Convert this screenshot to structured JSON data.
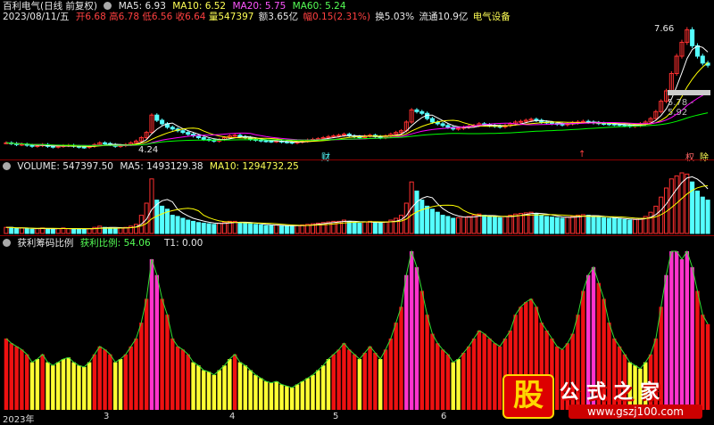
{
  "header": {
    "title": "百利电气(日线 前复权)",
    "ma5": "MA5: 6.93",
    "ma10": "MA10: 6.52",
    "ma20": "MA20: 5.75",
    "ma60": "MA60: 5.24"
  },
  "info": {
    "date": "2023/08/11/五",
    "open": "开6.68",
    "high": "高6.78",
    "low": "低6.56",
    "close": "收6.64",
    "volume": "量547397",
    "amount": "额3.65亿",
    "change": "幅0.15(2.31%)",
    "turnover": "换5.03%",
    "float_cap": "流通10.9亿",
    "sector": "电气设备"
  },
  "price_panel": {
    "high_label": "7.66",
    "low_label": "4.24",
    "range_label": "5.78 - 5.92",
    "marker_cai": "财",
    "marker_right1": "权",
    "marker_right2": "除",
    "marker_mid": "↑"
  },
  "volume_panel": {
    "volume": "VOLUME: 547397.50",
    "ma5": "MA5: 1493129.38",
    "ma10": "MA10: 1294732.25"
  },
  "profit_panel": {
    "title": "获利筹码比例",
    "ratio": "获利比例: 54.06",
    "t1": "T1: 0.00"
  },
  "dates": [
    "2023年",
    "3",
    "4",
    "5",
    "6"
  ],
  "watermark": {
    "logo": "股",
    "title": "公式之家",
    "url": "www.gszj100.com"
  },
  "colors": {
    "up": "#ff3030",
    "down": "#55ffff",
    "ma5": "#ffffff",
    "ma10": "#ffff00",
    "ma20": "#ff00ff",
    "ma60": "#00ff00",
    "profit_high": "#ff33cc",
    "profit_mid": "#ee1111",
    "profit_low": "#ffff33"
  },
  "chart_data": [
    {
      "type": "candlestick",
      "title": "百利电气(日线 前复权)",
      "series": [
        {
          "name": "MA5",
          "value": 6.93
        },
        {
          "name": "MA10",
          "value": 6.52
        },
        {
          "name": "MA20",
          "value": 5.75
        },
        {
          "name": "MA60",
          "value": 5.24
        }
      ],
      "close": [
        4.4,
        4.38,
        4.35,
        4.36,
        4.33,
        4.3,
        4.32,
        4.35,
        4.3,
        4.28,
        4.3,
        4.32,
        4.33,
        4.3,
        4.28,
        4.27,
        4.3,
        4.35,
        4.4,
        4.38,
        4.35,
        4.3,
        4.32,
        4.35,
        4.4,
        4.45,
        4.55,
        4.7,
        5.2,
        5.05,
        4.95,
        4.85,
        4.8,
        4.75,
        4.7,
        4.65,
        4.6,
        4.55,
        4.5,
        4.48,
        4.45,
        4.5,
        4.55,
        4.6,
        4.62,
        4.58,
        4.55,
        4.5,
        4.48,
        4.46,
        4.45,
        4.44,
        4.45,
        4.43,
        4.42,
        4.4,
        4.42,
        4.45,
        4.48,
        4.5,
        4.52,
        4.55,
        4.58,
        4.6,
        4.62,
        4.65,
        4.6,
        4.58,
        4.55,
        4.6,
        4.62,
        4.58,
        4.55,
        4.6,
        4.65,
        4.7,
        4.75,
        5.0,
        5.35,
        5.3,
        5.25,
        5.1,
        5.0,
        4.95,
        4.9,
        4.85,
        4.8,
        4.82,
        4.85,
        4.88,
        4.9,
        4.95,
        4.92,
        4.9,
        4.88,
        4.86,
        4.9,
        4.95,
        5.0,
        5.02,
        5.05,
        5.08,
        5.05,
        5.0,
        4.98,
        4.96,
        4.94,
        4.92,
        4.95,
        4.98,
        5.0,
        5.02,
        5.0,
        4.98,
        4.96,
        4.95,
        4.94,
        4.93,
        4.92,
        4.9,
        4.88,
        4.9,
        4.95,
        5.0,
        5.1,
        5.3,
        5.6,
        5.9,
        6.4,
        6.9,
        7.3,
        7.66,
        7.2,
        6.9,
        6.7,
        6.64
      ]
    },
    {
      "type": "bar",
      "title": "VOLUME",
      "series": [
        {
          "name": "VOLUME",
          "values": [
            0.1,
            0.1,
            0.08,
            0.09,
            0.08,
            0.07,
            0.08,
            0.09,
            0.08,
            0.07,
            0.08,
            0.09,
            0.08,
            0.08,
            0.07,
            0.07,
            0.08,
            0.1,
            0.12,
            0.1,
            0.09,
            0.08,
            0.09,
            0.1,
            0.12,
            0.15,
            0.3,
            0.5,
            0.9,
            0.55,
            0.45,
            0.4,
            0.3,
            0.28,
            0.25,
            0.22,
            0.2,
            0.18,
            0.17,
            0.16,
            0.15,
            0.17,
            0.18,
            0.2,
            0.2,
            0.18,
            0.17,
            0.16,
            0.15,
            0.14,
            0.13,
            0.13,
            0.14,
            0.13,
            0.12,
            0.12,
            0.13,
            0.14,
            0.15,
            0.16,
            0.17,
            0.18,
            0.19,
            0.2,
            0.2,
            0.22,
            0.2,
            0.18,
            0.17,
            0.19,
            0.2,
            0.18,
            0.17,
            0.19,
            0.22,
            0.25,
            0.3,
            0.5,
            0.85,
            0.7,
            0.55,
            0.45,
            0.4,
            0.35,
            0.3,
            0.28,
            0.25,
            0.26,
            0.27,
            0.28,
            0.3,
            0.32,
            0.3,
            0.28,
            0.27,
            0.26,
            0.28,
            0.3,
            0.32,
            0.33,
            0.34,
            0.35,
            0.33,
            0.3,
            0.28,
            0.27,
            0.26,
            0.25,
            0.27,
            0.28,
            0.3,
            0.31,
            0.3,
            0.28,
            0.27,
            0.26,
            0.25,
            0.25,
            0.24,
            0.23,
            0.22,
            0.23,
            0.25,
            0.28,
            0.35,
            0.45,
            0.6,
            0.75,
            0.9,
            0.95,
            1.0,
            0.98,
            0.85,
            0.7,
            0.6,
            0.55
          ]
        }
      ]
    },
    {
      "type": "bar",
      "title": "获利筹码比例",
      "series": [
        {
          "name": "获利比例",
          "values": [
            45,
            42,
            40,
            38,
            35,
            30,
            32,
            35,
            30,
            28,
            30,
            32,
            33,
            30,
            28,
            27,
            30,
            35,
            40,
            38,
            35,
            30,
            32,
            35,
            40,
            45,
            55,
            70,
            95,
            85,
            70,
            60,
            45,
            40,
            38,
            35,
            30,
            28,
            25,
            24,
            22,
            25,
            28,
            32,
            35,
            30,
            28,
            25,
            22,
            20,
            18,
            17,
            18,
            16,
            15,
            14,
            16,
            18,
            20,
            22,
            25,
            28,
            32,
            35,
            38,
            42,
            38,
            35,
            32,
            36,
            40,
            36,
            32,
            38,
            45,
            55,
            65,
            85,
            100,
            90,
            75,
            60,
            48,
            42,
            38,
            35,
            30,
            32,
            36,
            40,
            45,
            50,
            48,
            45,
            42,
            40,
            45,
            50,
            60,
            65,
            68,
            70,
            65,
            55,
            50,
            45,
            40,
            38,
            42,
            48,
            60,
            75,
            85,
            90,
            80,
            70,
            55,
            45,
            40,
            35,
            30,
            28,
            26,
            30,
            35,
            45,
            65,
            85,
            100,
            100,
            95,
            100,
            90,
            75,
            60,
            54.06
          ]
        }
      ]
    }
  ]
}
